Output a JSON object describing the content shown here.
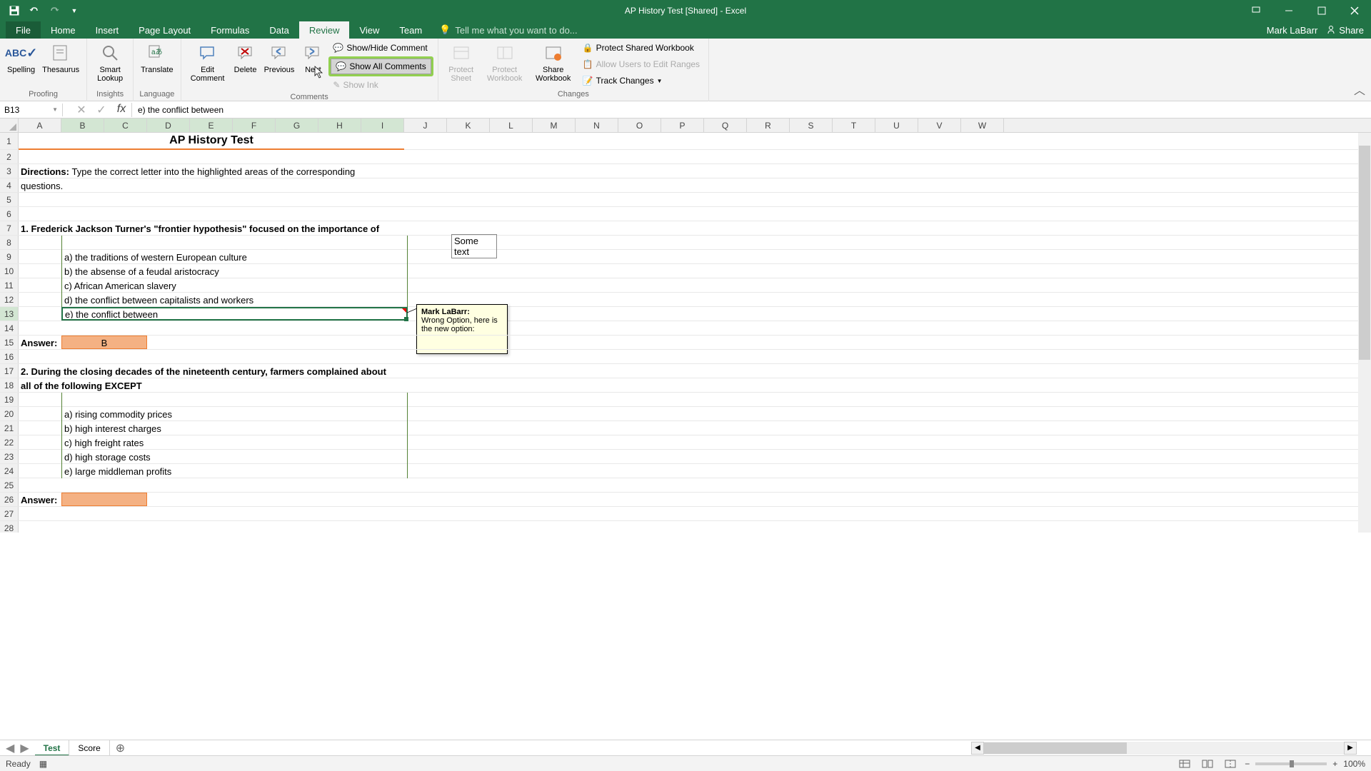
{
  "app": {
    "title": "AP History Test  [Shared] - Excel"
  },
  "user": {
    "name": "Mark LaBarr",
    "share_label": "Share"
  },
  "tabs": {
    "file": "File",
    "home": "Home",
    "insert": "Insert",
    "page_layout": "Page Layout",
    "formulas": "Formulas",
    "data": "Data",
    "review": "Review",
    "view": "View",
    "team": "Team",
    "tell_me": "Tell me what you want to do..."
  },
  "ribbon": {
    "proofing": {
      "label": "Proofing",
      "spelling": "Spelling",
      "thesaurus": "Thesaurus"
    },
    "insights": {
      "label": "Insights",
      "smart_lookup": "Smart Lookup"
    },
    "language": {
      "label": "Language",
      "translate": "Translate"
    },
    "comments": {
      "label": "Comments",
      "edit": "Edit Comment",
      "delete": "Delete",
      "previous": "Previous",
      "next": "Next",
      "show_hide": "Show/Hide Comment",
      "show_all": "Show All Comments",
      "show_ink": "Show Ink"
    },
    "changes": {
      "label": "Changes",
      "protect_sheet": "Protect Sheet",
      "protect_workbook": "Protect Workbook",
      "share_workbook": "Share Workbook",
      "protect_shared": "Protect Shared Workbook",
      "allow_edit": "Allow Users to Edit Ranges",
      "track_changes": "Track Changes"
    }
  },
  "formula_bar": {
    "name_box": "B13",
    "formula": "e) the conflict between"
  },
  "columns": [
    "A",
    "B",
    "C",
    "D",
    "E",
    "F",
    "G",
    "H",
    "I",
    "J",
    "K",
    "L",
    "M",
    "N",
    "O",
    "P",
    "Q",
    "R",
    "S",
    "T",
    "U",
    "V",
    "W"
  ],
  "sheet": {
    "title": "AP History Test",
    "directions_label": "Directions:",
    "directions_text": "Type the correct letter into the highlighted areas of the corresponding questions.",
    "q1": {
      "text": "1. Frederick Jackson Turner's \"frontier hypothesis\" focused on the importance of",
      "a": "a) the traditions of western European culture",
      "b": "b) the absense of a feudal aristocracy",
      "c": "c) African American slavery",
      "d": "d) the conflict between capitalists and workers",
      "e": "e) the conflict between",
      "answer_label": "Answer:",
      "answer_value": "B"
    },
    "q2": {
      "text_line1": "2. During the closing decades of the nineteenth century, farmers complained about",
      "text_line2": "all of the following EXCEPT",
      "a": "a) rising commodity prices",
      "b": "b) high interest charges",
      "c": "c) high freight rates",
      "d": "d) high storage costs",
      "e": "e) large middleman profits",
      "answer_label": "Answer:"
    },
    "floating_text": "Some text"
  },
  "comment": {
    "author": "Mark LaBarr:",
    "text": "Wrong Option, here is the new option:"
  },
  "sheet_tabs": {
    "test": "Test",
    "score": "Score"
  },
  "status": {
    "ready": "Ready",
    "zoom": "100%"
  }
}
